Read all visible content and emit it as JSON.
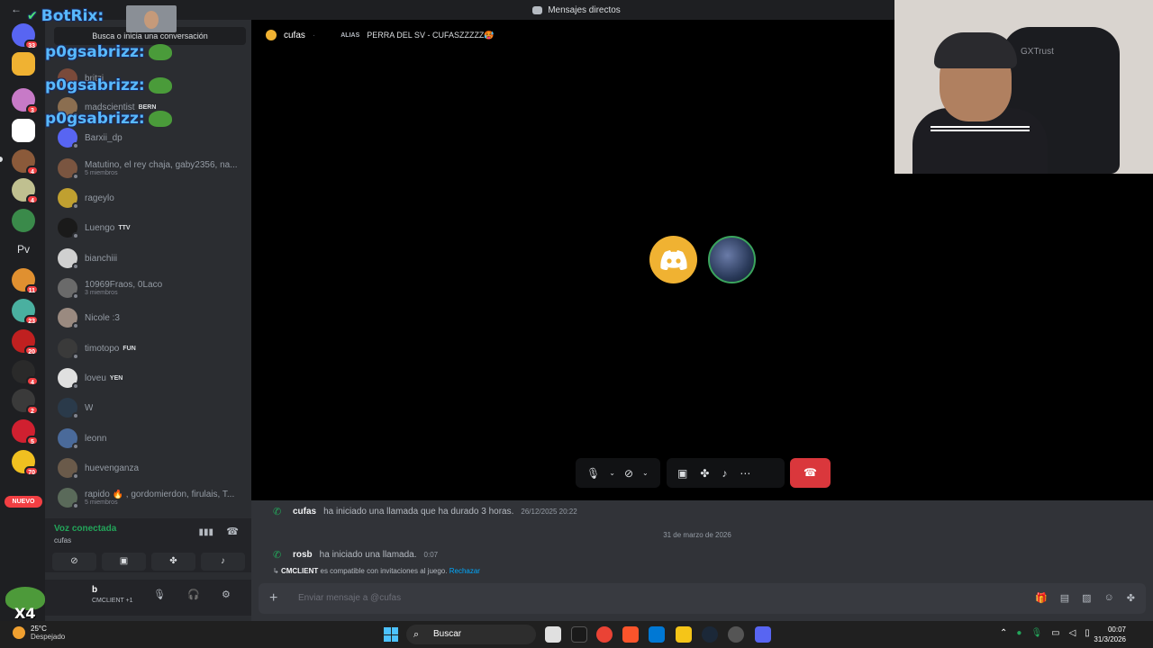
{
  "titlebar": {
    "title": "Mensajes directos"
  },
  "guilds": {
    "badges": [
      "33",
      "3",
      "4",
      "4",
      "11",
      "23",
      "20",
      "4",
      "2",
      "5",
      "70"
    ],
    "pv_label": "Pv",
    "nuevo": "NUEVO"
  },
  "dm_search": {
    "placeholder": "Busca o inicia una conversación"
  },
  "overlays": [
    {
      "name": "BotRix:"
    },
    {
      "name": "p0gsabrizz:"
    },
    {
      "name": "p0gsabrizz:"
    },
    {
      "name": "p0gsabrizz:"
    }
  ],
  "dms": [
    {
      "name": "britzi",
      "sub": "",
      "tag": "",
      "color": "#7a4a3a"
    },
    {
      "name": "madscientist",
      "sub": "",
      "tag": "BERN",
      "color": "#8b6e50"
    },
    {
      "name": "Barxii_dp",
      "sub": "",
      "tag": "",
      "color": "#5865f2"
    },
    {
      "name": "Matutino, el rey chaja, gaby2356, na...",
      "sub": "5 miembros",
      "tag": "",
      "color": "#7a5540"
    },
    {
      "name": "rageylo",
      "sub": "",
      "tag": "",
      "color": "#c0a030"
    },
    {
      "name": "Luengo",
      "sub": "",
      "tag": "TTV",
      "color": "#1a1a1a"
    },
    {
      "name": "bianchiii",
      "sub": "",
      "tag": "",
      "color": "#d0d0d0"
    },
    {
      "name": "10969Fraos, 0Laco",
      "sub": "3 miembros",
      "tag": "",
      "color": "#6a6a6a"
    },
    {
      "name": "Nicole :3",
      "sub": "",
      "tag": "",
      "color": "#9a8a80"
    },
    {
      "name": "timotopo",
      "sub": "",
      "tag": "FUN",
      "color": "#3a3a3a"
    },
    {
      "name": "loveu",
      "sub": "",
      "tag": "YEN",
      "color": "#e0e0e0"
    },
    {
      "name": "W",
      "sub": "",
      "tag": "",
      "color": "#2a3a4a"
    },
    {
      "name": "leonn",
      "sub": "",
      "tag": "",
      "color": "#4a6a9a"
    },
    {
      "name": "huevenganza",
      "sub": "",
      "tag": "",
      "color": "#6a5a4a"
    },
    {
      "name": "rapido 🔥 , gordomierdon, firulais, T...",
      "sub": "5 miembros",
      "tag": "",
      "color": "#5a6a5a"
    }
  ],
  "voice": {
    "title": "Voz conectada",
    "channel": "cufas"
  },
  "user": {
    "name": "b",
    "status": "CMCLIENT +1"
  },
  "header": {
    "name": "cufas",
    "alias_label": "ALIAS",
    "alias": "PERRA DEL SV - CUFASZZZZZ🥵"
  },
  "webcam": {
    "brand": "GXTrust"
  },
  "chat": {
    "msg1": {
      "user": "cufas",
      "text": "ha iniciado una llamada que ha durado 3 horas.",
      "time": "26/12/2025 20:22"
    },
    "date": "31 de marzo de 2026",
    "msg2": {
      "user": "rosb",
      "text": "ha iniciado una llamada.",
      "time": "0:07"
    },
    "system": {
      "app": "CMCLIENT",
      "text": "es compatible con invitaciones al juego.",
      "link": "Rechazar"
    },
    "input_placeholder": "Enviar mensaje a @cufas"
  },
  "taskbar": {
    "temp": "25°C",
    "condition": "Despejado",
    "search": "Buscar",
    "time": "00:07",
    "date": "31/3/2026"
  },
  "xbox_label": "X4"
}
